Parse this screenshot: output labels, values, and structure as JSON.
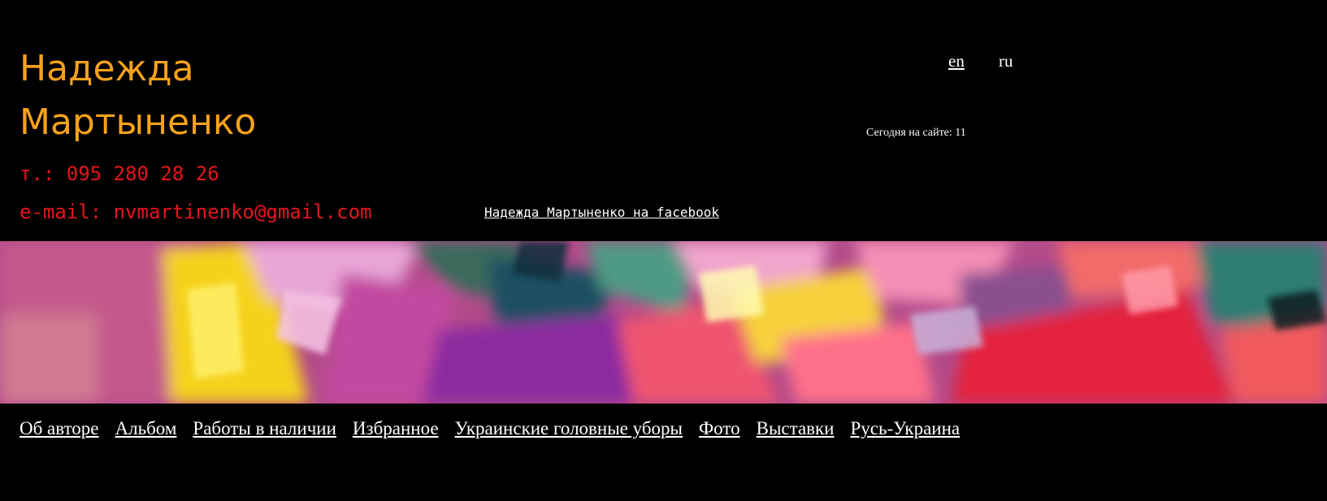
{
  "header": {
    "name_line1": "Надежда",
    "name_line2": "Мартыненко",
    "phone": "т.: 095 280 28 26",
    "email": "e-mail: nvmartinenko@gmail.com",
    "facebook_link": "Надежда Мартыненко на facebook"
  },
  "languages": [
    "en",
    "ru"
  ],
  "visitors": "Сегодня на сайте: 11",
  "nav": [
    "Об авторе",
    "Альбом",
    "Работы в наличии",
    "Избранное",
    "Украинские головные уборы",
    "Фото",
    "Выставки",
    "Русь-Украина"
  ],
  "colors": {
    "background": "#000000",
    "name": "#f7a21b",
    "contacts": "#e8141e",
    "links": "#ffffff"
  }
}
